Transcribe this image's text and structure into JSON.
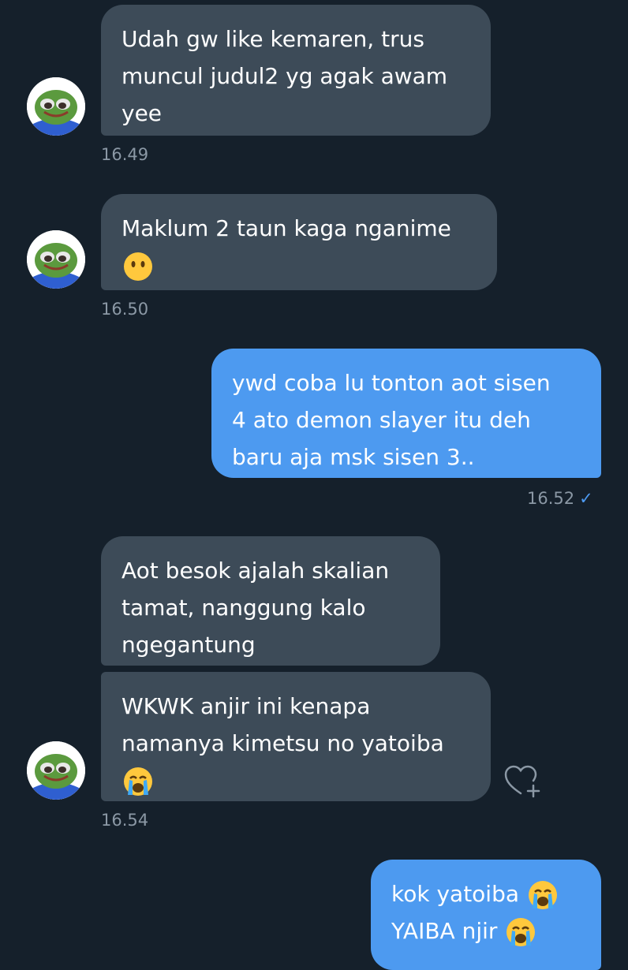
{
  "messages": [
    {
      "lines": [
        "Udah gw like kemaren, trus",
        "muncul judul2 yg agak awam",
        "yee"
      ],
      "time": "16.49"
    },
    {
      "lines": [
        "Maklum 2 taun kaga nganime"
      ],
      "emoji": "neutral-face",
      "time": "16.50"
    },
    {
      "lines": [
        "ywd coba lu tonton aot sisen",
        "4 ato demon slayer itu deh",
        "baru aja msk sisen 3.."
      ],
      "time": "16.52",
      "status": "✓"
    },
    {
      "lines": [
        "Aot besok ajalah skalian",
        "tamat, nanggung kalo",
        "ngegantung"
      ]
    },
    {
      "lines": [
        "WKWK anjir ini kenapa",
        "namanya kimetsu no yatoiba"
      ],
      "emoji": "loudly-crying-face",
      "time": "16.54"
    },
    {
      "lines": [
        "kok yatoiba",
        "YAIBA njir"
      ],
      "emoji": "loudly-crying-face"
    }
  ],
  "icons": {
    "avatar": "pepe-frog-avatar",
    "reaction": "heart-plus-icon"
  },
  "colors": {
    "background": "#15202b",
    "incoming_bubble": "#3d4b58",
    "outgoing_bubble": "#4d9af0",
    "timestamp": "#8b98a5"
  }
}
